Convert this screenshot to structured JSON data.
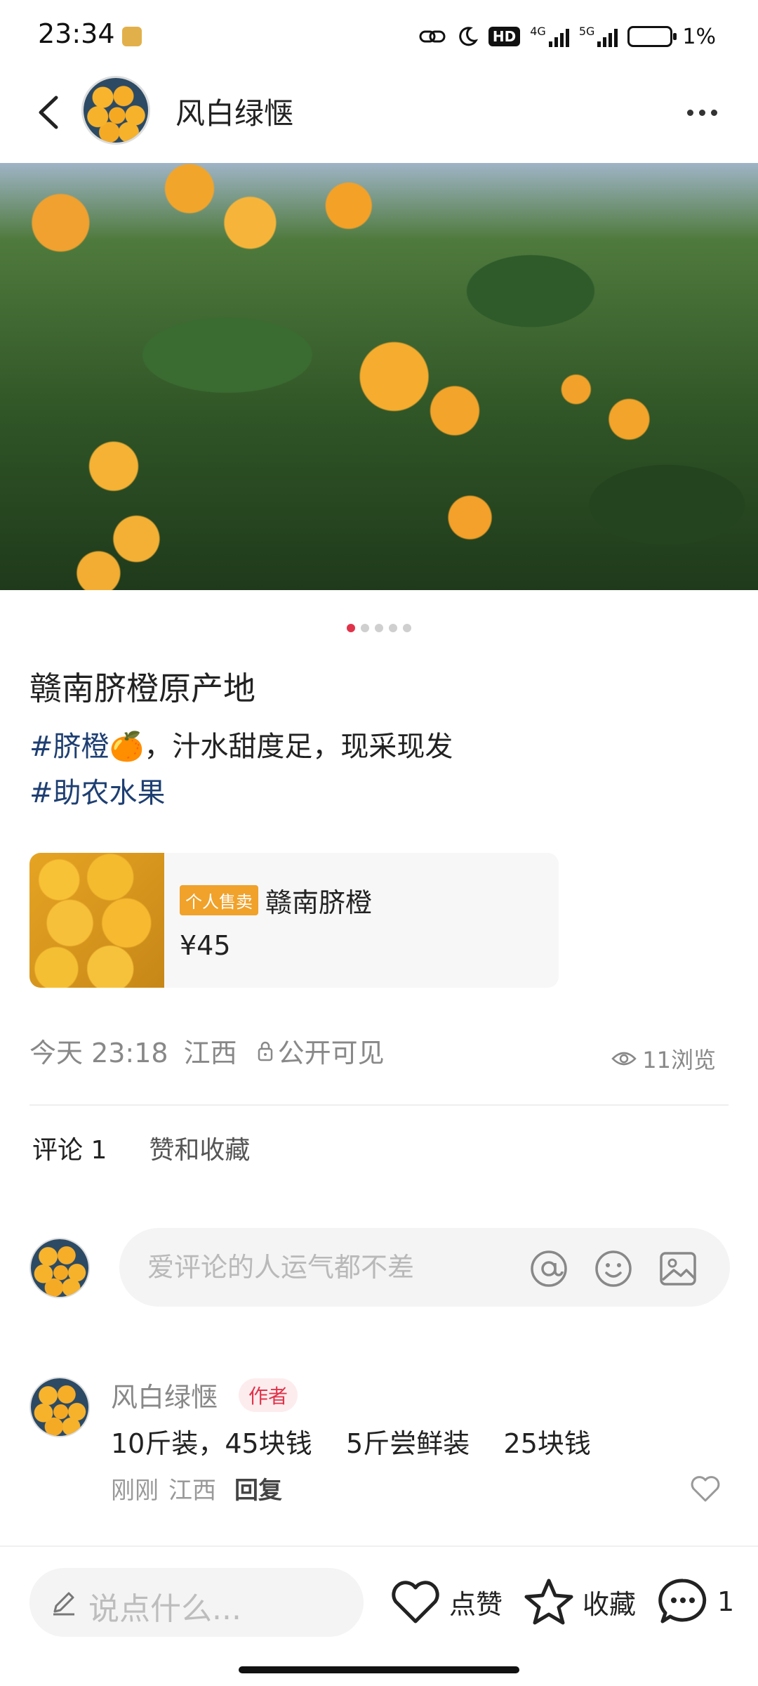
{
  "status_bar": {
    "time": "23:34",
    "network_4g": "4G",
    "network_5g": "5G",
    "hd": "HD",
    "battery": "1%"
  },
  "header": {
    "author_name": "风白绿惬",
    "back_icon": "chevron-left-icon",
    "more_icon": "more-dots-icon"
  },
  "gallery": {
    "image_count": 5,
    "active_index": 0
  },
  "post": {
    "title": "赣南脐橙原产地",
    "tag1": "#脐橙🍊",
    "body_text": "，汁水甜度足，现采现发",
    "tag2": "#助农水果"
  },
  "product": {
    "badge": "个人售卖",
    "name": "赣南脐橙",
    "price": "¥45"
  },
  "meta": {
    "time": "今天 23:18",
    "location": "江西",
    "visibility": "公开可见",
    "views": "11浏览"
  },
  "tabs": {
    "comments": "评论 1",
    "likes": "赞和收藏"
  },
  "comment_input": {
    "placeholder": "爱评论的人运气都不差"
  },
  "comments": [
    {
      "author": "风白绿惬",
      "badge": "作者",
      "text": "10斤装，45块钱    5斤尝鲜装    25块钱",
      "time": "刚刚",
      "location": "江西",
      "reply": "回复"
    }
  ],
  "bottom_bar": {
    "say_placeholder": "说点什么...",
    "like_label": "点赞",
    "collect_label": "收藏",
    "comment_count": "1"
  },
  "colors": {
    "accent": "#e0334a",
    "tag": "#1e3f72",
    "badge": "#f0a22a"
  }
}
